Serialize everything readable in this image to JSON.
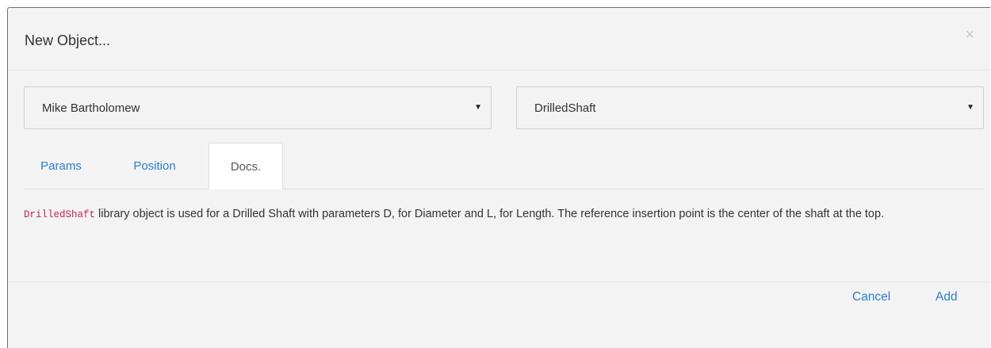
{
  "dialog": {
    "title": "New Object...",
    "close_label": "×"
  },
  "selects": {
    "user": {
      "value": "Mike Bartholomew",
      "arrow": "▼"
    },
    "object_type": {
      "value": "DrilledShaft",
      "arrow": "▼"
    }
  },
  "tabs": [
    {
      "label": "Params",
      "active": false
    },
    {
      "label": "Position",
      "active": false
    },
    {
      "label": "Docs.",
      "active": true
    }
  ],
  "docs": {
    "code": "DrilledShaft",
    "text": "library object is used for a Drilled Shaft with parameters D, for Diameter and L, for Length. The reference insertion point is the center of the shaft at the top."
  },
  "footer": {
    "cancel_label": "Cancel",
    "add_label": "Add"
  },
  "colors": {
    "link": "#2a7fd4",
    "code": "#c7254e",
    "background": "#f3f3f3"
  }
}
